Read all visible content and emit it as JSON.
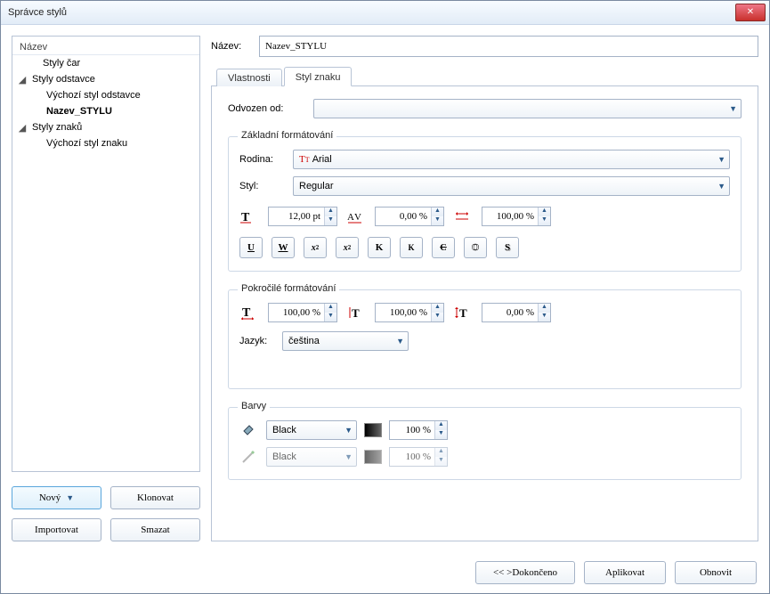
{
  "title": "Správce stylů",
  "tree": {
    "header": "Název",
    "lines_style": "Styly čar",
    "para_styles": "Styly odstavce",
    "default_para": "Výchozí styl odstavce",
    "nazev_stylu": "Nazev_STYLU",
    "char_styles": "Styly znaků",
    "default_char": "Výchozí styl znaku"
  },
  "left_buttons": {
    "new": "Nový",
    "clone": "Klonovat",
    "import": "Importovat",
    "delete": "Smazat"
  },
  "name_label": "Název:",
  "name_value": "Nazev_STYLU",
  "tabs": {
    "properties": "Vlastnosti",
    "char_style": "Styl znaku"
  },
  "derived_label": "Odvozen od:",
  "derived_value": "",
  "basic_group": "Základní formátování",
  "family_label": "Rodina:",
  "family_value": "Arial",
  "style_label": "Styl:",
  "style_value": "Regular",
  "spin_size": "12,00 pt",
  "spin_track": "0,00 %",
  "spin_hscale": "100,00 %",
  "advanced_group": "Pokročilé formátování",
  "adv_spin1": "100,00 %",
  "adv_spin2": "100,00 %",
  "adv_spin3": "0,00 %",
  "lang_label": "Jazyk:",
  "lang_value": "čeština",
  "colors_group": "Barvy",
  "color_fill_name": "Black",
  "color_fill_pct": "100 %",
  "color_stroke_name": "Black",
  "color_stroke_pct": "100 %",
  "footer": {
    "done": "<< >Dokončeno",
    "apply": "Aplikovat",
    "reset": "Obnovit"
  }
}
